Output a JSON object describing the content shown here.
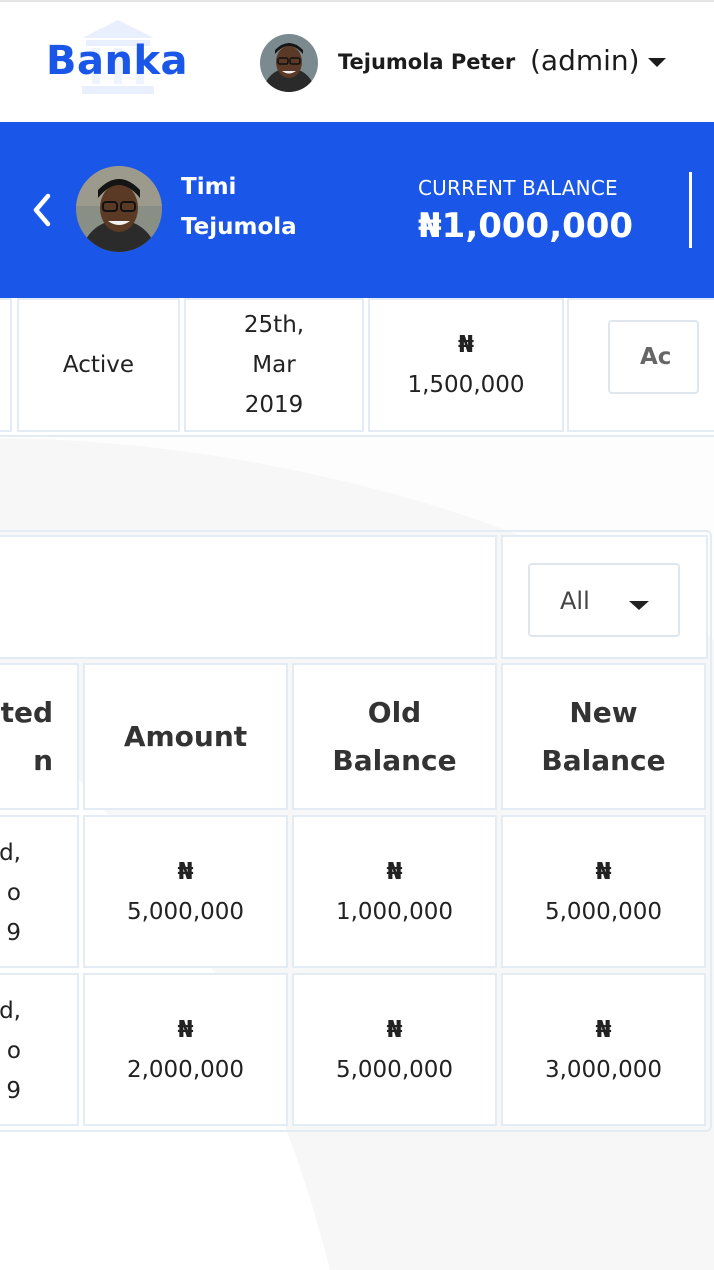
{
  "brand": {
    "name": "Banka",
    "accent": "#1a56e8"
  },
  "user": {
    "name": "Tejumola Peter",
    "role": "(admin)"
  },
  "banner": {
    "client_first_name": "Timi",
    "client_last_name": "Tejumola",
    "balance_label": "CURRENT BALANCE",
    "balance_value": "₦1,000,000"
  },
  "account_info": {
    "status": "Active",
    "date_line1": "25th,",
    "date_line2": "Mar",
    "date_line3": "2019",
    "currency_symbol": "₦",
    "amount": "1,500,000",
    "action_label": "Ac"
  },
  "filter": {
    "value": "All"
  },
  "table": {
    "headers": {
      "date_line1": "ted",
      "date_line2": "n",
      "amount": "Amount",
      "old_balance_line1": "Old",
      "old_balance_line2": "Balance",
      "new_balance_line1": "New",
      "new_balance_line2": "Balance"
    },
    "rows": [
      {
        "date_line1": "d,",
        "date_line2": "o",
        "date_line3": "9",
        "currency": "₦",
        "amount": "5,000,000",
        "old_balance": "1,000,000",
        "new_balance": "5,000,000"
      },
      {
        "date_line1": "d,",
        "date_line2": "o",
        "date_line3": "9",
        "currency": "₦",
        "amount": "2,000,000",
        "old_balance": "5,000,000",
        "new_balance": "3,000,000"
      }
    ]
  }
}
